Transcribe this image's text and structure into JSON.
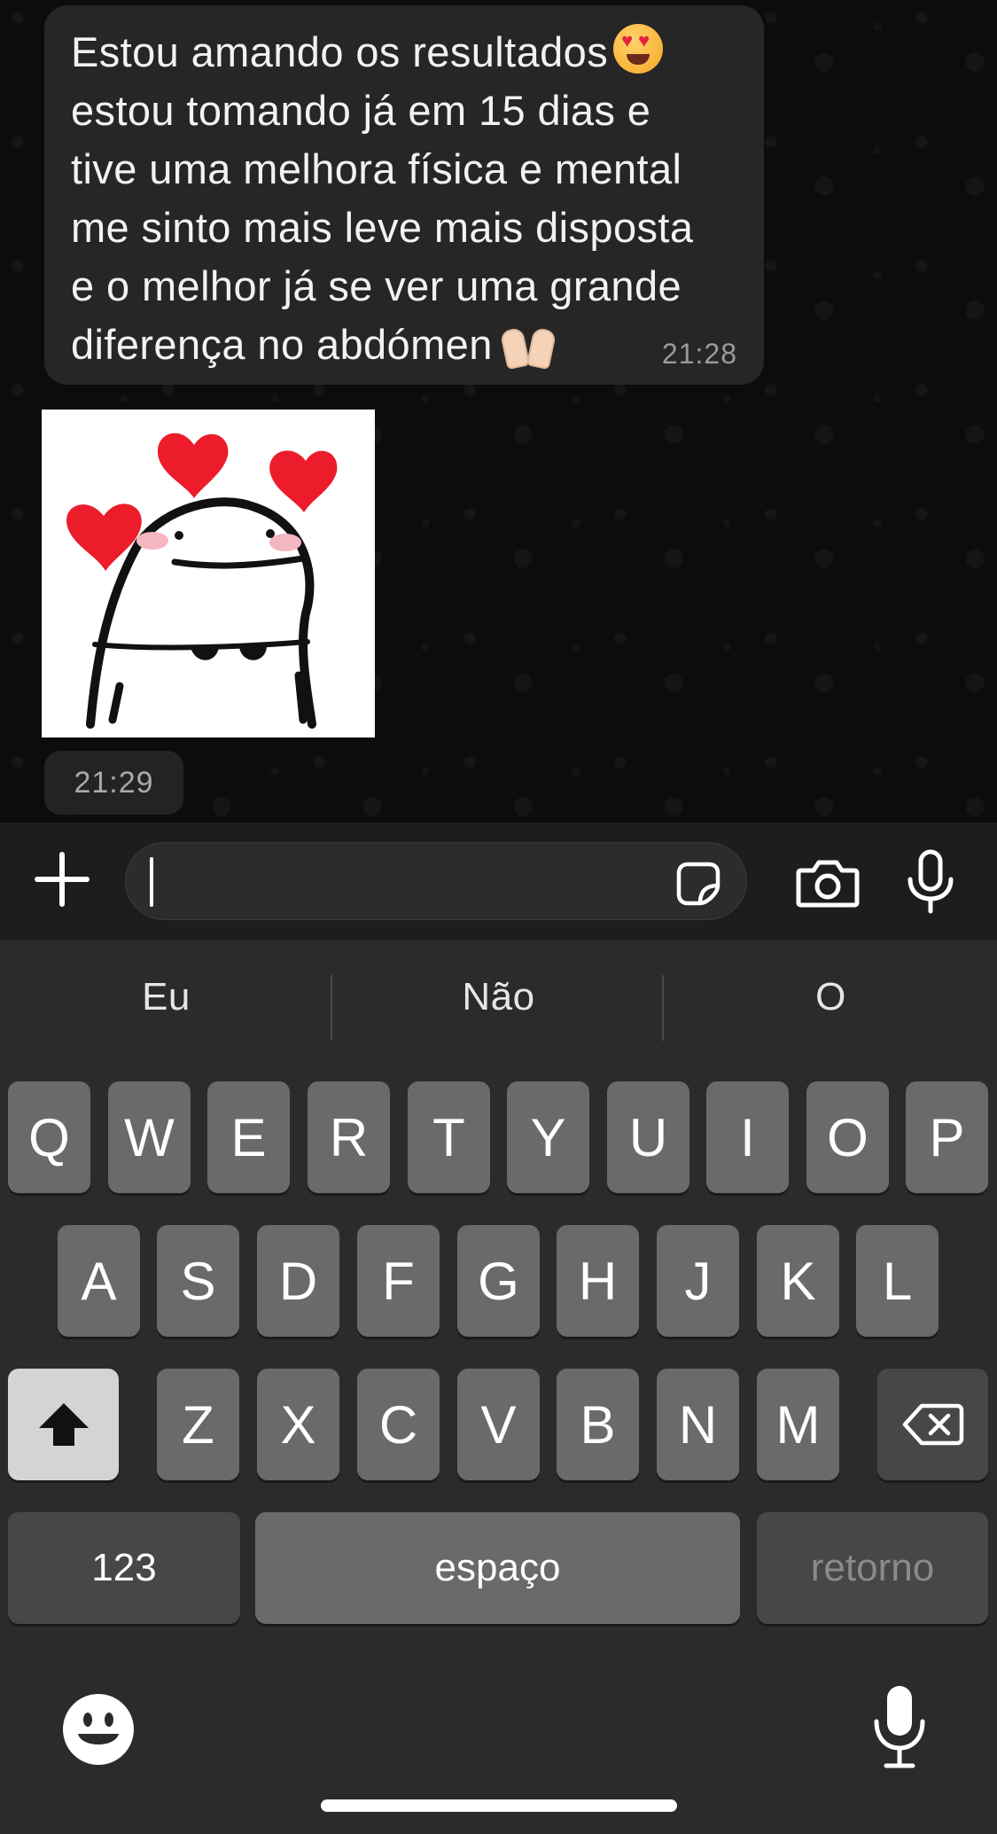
{
  "chat": {
    "message": {
      "line1": "Estou amando os resultados",
      "body": "estou tomando já em 15 dias e\ntive uma melhora física e mental\nme sinto mais leve mais disposta\ne o melhor já se ver uma grande\ndiferença no abdómen",
      "time": "21:28",
      "emoji_1": "heart-eyes-emoji",
      "emoji_2": "raising-hands-emoji"
    },
    "sticker": {
      "icon": "flork-hearts-sticker",
      "time": "21:29"
    }
  },
  "input_bar": {
    "plus_icon": "plus-icon",
    "text_value": "",
    "sticker_icon": "sticker-icon",
    "camera_icon": "camera-icon",
    "mic_icon": "microphone-icon"
  },
  "keyboard": {
    "suggestions": [
      "Eu",
      "Não",
      "O"
    ],
    "row1": [
      "Q",
      "W",
      "E",
      "R",
      "T",
      "Y",
      "U",
      "I",
      "O",
      "P"
    ],
    "row2": [
      "A",
      "S",
      "D",
      "F",
      "G",
      "H",
      "J",
      "K",
      "L"
    ],
    "row3": [
      "Z",
      "X",
      "C",
      "V",
      "B",
      "N",
      "M"
    ],
    "numbers_label": "123",
    "space_label": "espaço",
    "return_label": "retorno",
    "shift_icon": "shift-icon",
    "delete_icon": "backspace-icon",
    "emoji_icon": "emoji-keyboard-icon",
    "dictation_icon": "dictation-mic-icon"
  },
  "colors": {
    "bubble": "#262626",
    "key": "#6a6a6a",
    "key_dark": "#474747",
    "keyboard_bg": "#2b2b2b"
  }
}
